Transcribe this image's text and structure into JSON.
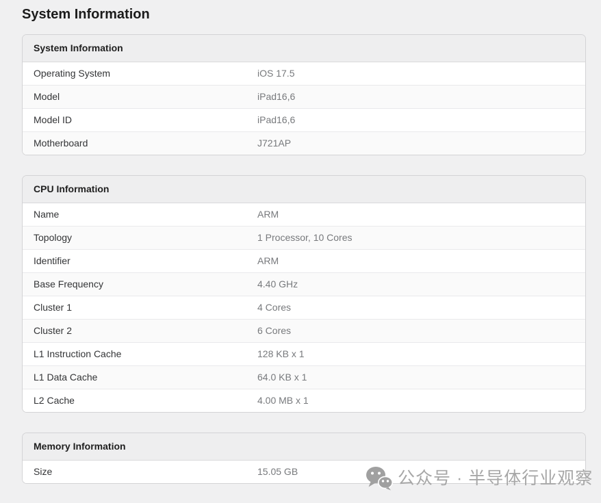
{
  "page": {
    "title": "System Information"
  },
  "sections": [
    {
      "title": "System Information",
      "rows": [
        {
          "label": "Operating System",
          "value": "iOS 17.5"
        },
        {
          "label": "Model",
          "value": "iPad16,6"
        },
        {
          "label": "Model ID",
          "value": "iPad16,6"
        },
        {
          "label": "Motherboard",
          "value": "J721AP"
        }
      ]
    },
    {
      "title": "CPU Information",
      "rows": [
        {
          "label": "Name",
          "value": "ARM"
        },
        {
          "label": "Topology",
          "value": "1 Processor, 10 Cores"
        },
        {
          "label": "Identifier",
          "value": "ARM"
        },
        {
          "label": "Base Frequency",
          "value": "4.40 GHz"
        },
        {
          "label": "Cluster 1",
          "value": "4 Cores"
        },
        {
          "label": "Cluster 2",
          "value": "6 Cores"
        },
        {
          "label": "L1 Instruction Cache",
          "value": "128 KB x 1"
        },
        {
          "label": "L1 Data Cache",
          "value": "64.0 KB x 1"
        },
        {
          "label": "L2 Cache",
          "value": "4.00 MB x 1"
        }
      ]
    },
    {
      "title": "Memory Information",
      "rows": [
        {
          "label": "Size",
          "value": "15.05 GB"
        }
      ]
    }
  ],
  "watermark": {
    "icon": "wechat-icon",
    "text": "公众号 · 半导体行业观察"
  },
  "colors": {
    "page_bg": "#f0f0f1",
    "card_bg": "#ffffff",
    "card_border": "#d3d3d5",
    "header_bg": "#eeeeef",
    "label_text": "#333436",
    "value_text": "#77797c",
    "watermark": "#a7a7a7"
  }
}
